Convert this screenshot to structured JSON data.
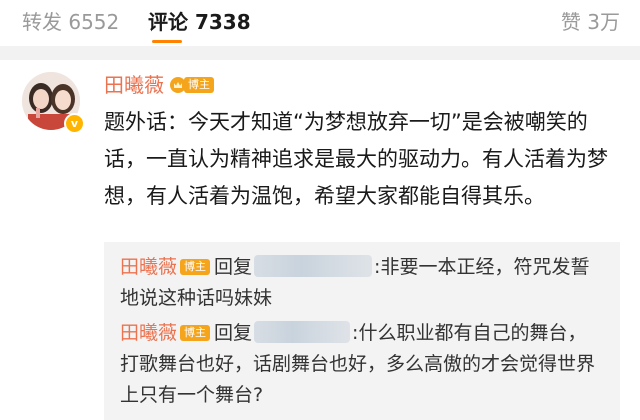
{
  "tabs": {
    "repost": "转发 6552",
    "comment": "评论 7338",
    "like": "赞 3万"
  },
  "colors": {
    "accent_orange": "#ff8200",
    "username": "#eb7350",
    "badge_gold": "#f4a51c"
  },
  "comment": {
    "username": "田曦薇",
    "author_tag": "博主",
    "verified_icon": "v-verified-icon",
    "text": "题外话：今天才知道“为梦想放弃一切”是会被嘲笑的话，一直认为精神追求是最大的驱动力。有人活着为梦想，有人活着为温饱，希望大家都能自得其乐。"
  },
  "replies": [
    {
      "username": "田曦薇",
      "tag": "博主",
      "reply_word": "回复",
      "text": "非要一本正经，符咒发誓地说这种话吗妹妹"
    },
    {
      "username": "田曦薇",
      "tag": "博主",
      "reply_word": "回复",
      "text": "什么职业都有自己的舞台，打歌舞台也好，话剧舞台也好，多么高傲的才会觉得世界上只有一个舞台?"
    }
  ]
}
